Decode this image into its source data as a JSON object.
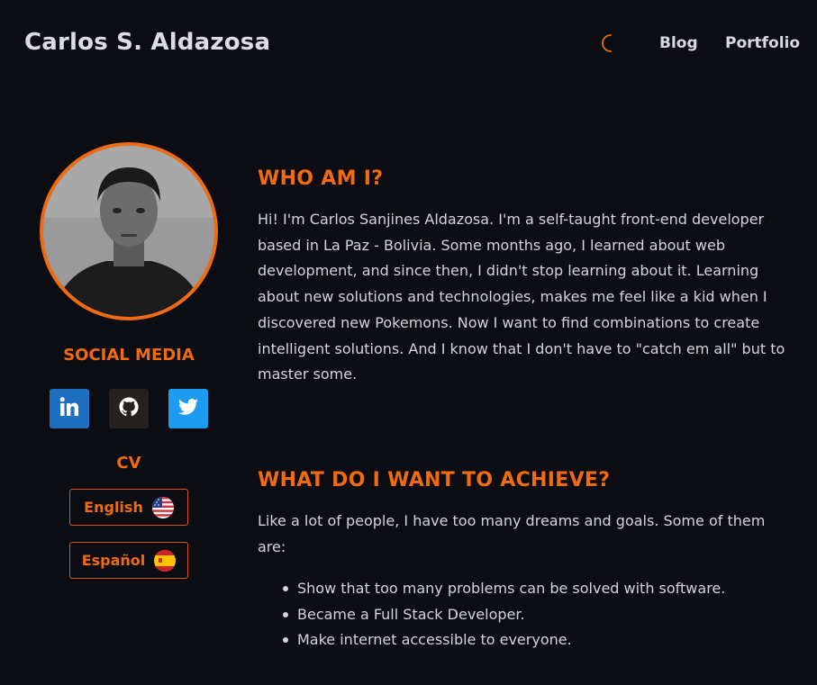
{
  "header": {
    "site_title": "Carlos S. Aldazosa",
    "theme_icon": "moon-icon",
    "nav": [
      {
        "label": "Blog"
      },
      {
        "label": "Portfolio"
      }
    ]
  },
  "sidebar": {
    "avatar_icon": "profile-photo",
    "social_title": "SOCIAL MEDIA",
    "social_links": [
      {
        "icon": "linkedin-icon",
        "color": "#1f6fc0"
      },
      {
        "icon": "github-icon",
        "color": "#24211f"
      },
      {
        "icon": "twitter-icon",
        "color": "#1d9bf0"
      }
    ],
    "cv_title": "CV",
    "cv_buttons": [
      {
        "label": "English",
        "icon": "us-flag-icon"
      },
      {
        "label": "Español",
        "icon": "spain-flag-icon"
      }
    ]
  },
  "main": {
    "about_title": "WHO AM I?",
    "about_text": "Hi! I'm Carlos Sanjines Aldazosa. I'm a self-taught front-end developer based in La Paz - Bolivia. Some months ago, I learned about web development, and since then, I didn't stop learning about it. Learning about new solutions and technologies, makes me feel like a kid when I discovered new Pokemons. Now I want to find combinations to create intelligent solutions. And I know that I don't have to \"catch em all\" but to master some.",
    "goals_title": "WHAT DO I WANT TO ACHIEVE?",
    "goals_intro": "Like a lot of people, I have too many dreams and goals. Some of them are:",
    "goals": [
      "Show that too many problems can be solved with software.",
      "Became a Full Stack Developer.",
      "Make internet accessible to everyone."
    ]
  },
  "colors": {
    "accent": "#f06a12",
    "background": "#0c0d12",
    "text": "#d4d4dc"
  }
}
